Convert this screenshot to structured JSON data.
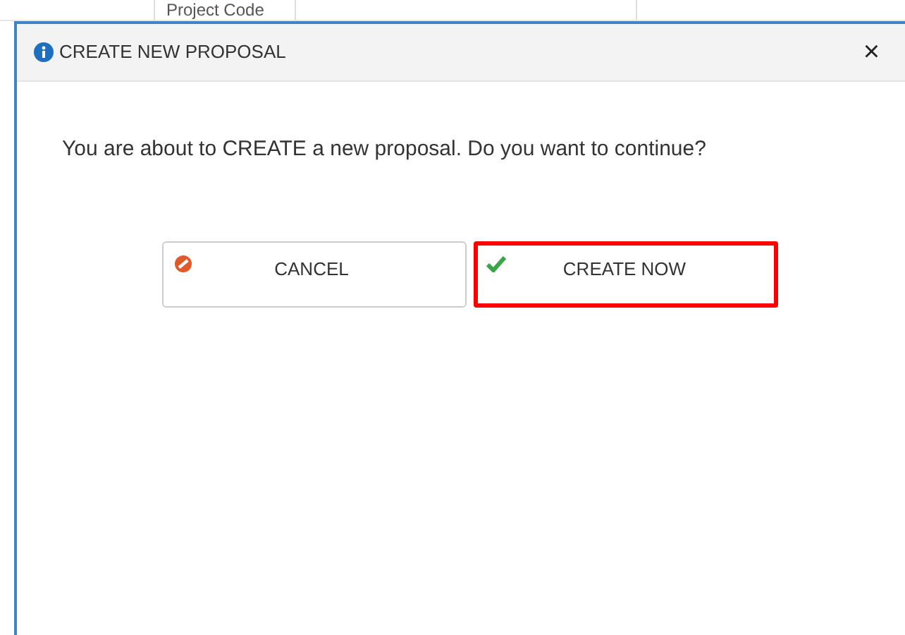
{
  "background_table": {
    "column_header": "Project Code"
  },
  "dialog": {
    "title": "CREATE NEW PROPOSAL",
    "close": "×",
    "message": "You are about to CREATE a new proposal. Do you want to continue?",
    "buttons": [
      {
        "kind": "cancel",
        "label": "CANCEL",
        "highlighted": false
      },
      {
        "kind": "confirm",
        "label": "CREATE NOW",
        "highlighted": true
      }
    ]
  }
}
